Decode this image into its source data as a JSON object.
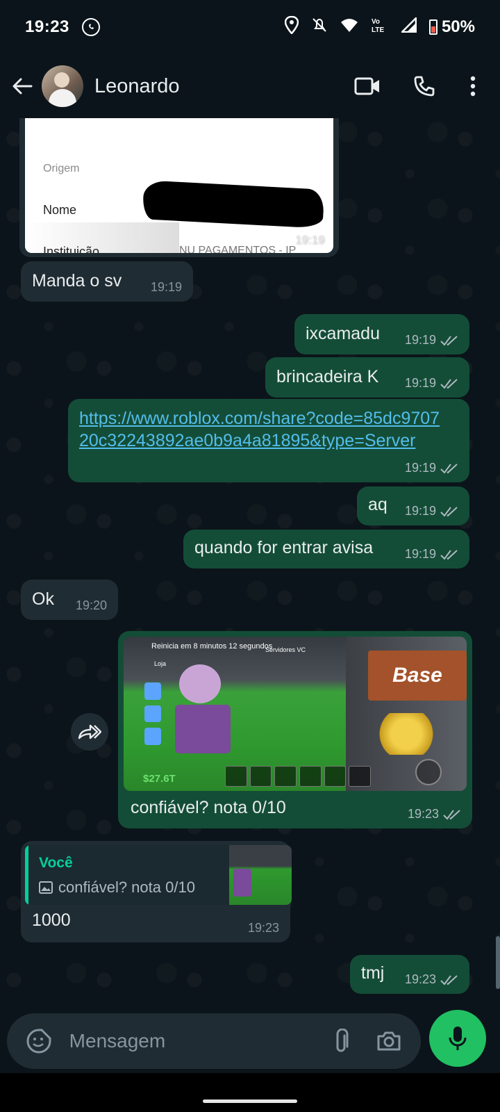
{
  "status_bar": {
    "time": "19:23",
    "battery": "50%",
    "icons": [
      "whatsapp-icon",
      "location-icon",
      "mute-icon",
      "wifi-icon",
      "volte-icon",
      "signal-icon",
      "battery-icon"
    ]
  },
  "header": {
    "contact_name": "Leonardo",
    "actions": [
      "video-call-icon",
      "voice-call-icon",
      "more-options-icon"
    ]
  },
  "receipt_image": {
    "labels": {
      "origem": "Origem",
      "nome": "Nome",
      "instituicao": "Instituição"
    },
    "bank": "NU PAGAMENTOS - IP",
    "time": "19:19"
  },
  "messages": [
    {
      "id": "m1",
      "direction": "in",
      "text": "Manda o sv",
      "time": "19:19"
    },
    {
      "id": "m2",
      "direction": "out",
      "text": "ixcamadu",
      "time": "19:19"
    },
    {
      "id": "m3",
      "direction": "out",
      "text": "brincadeira K",
      "time": "19:19"
    },
    {
      "id": "m4",
      "direction": "out",
      "link": "https://www.roblox.com/share?code=85dc970720c32243892ae0b9a4a81895&type=Server",
      "time": "19:19"
    },
    {
      "id": "m5",
      "direction": "out",
      "text": "aq",
      "time": "19:19"
    },
    {
      "id": "m6",
      "direction": "out",
      "text": "quando for entrar avisa",
      "time": "19:19"
    },
    {
      "id": "m7",
      "direction": "in",
      "text": "Ok",
      "time": "19:20"
    },
    {
      "id": "m8",
      "direction": "out",
      "caption": "confiável? nota 0/10",
      "time": "19:23",
      "image": {
        "hud_title": "Reinicia em 8 minutos 12 segundos",
        "sign": "Base",
        "money": "$27.6T",
        "servers": "Servidores VC",
        "shop": "Loja"
      }
    },
    {
      "id": "m9",
      "direction": "in",
      "reply_to": {
        "author": "Você",
        "text": "confiável? nota 0/10"
      },
      "text": "1000",
      "time": "19:23"
    },
    {
      "id": "m10",
      "direction": "out",
      "text": "tmj",
      "time": "19:23"
    }
  ],
  "composer": {
    "placeholder": "Mensagem"
  },
  "colors": {
    "background": "#0b141a",
    "incoming_bubble": "#202c33",
    "outgoing_bubble": "#144d37",
    "link": "#53bdeb",
    "accent": "#21c063"
  }
}
